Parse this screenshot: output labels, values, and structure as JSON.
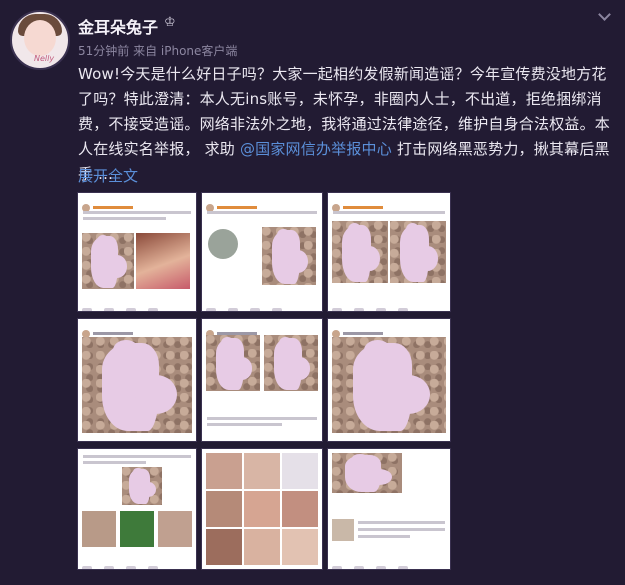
{
  "user": {
    "name": "金耳朵兔子",
    "avatar_caption": "Nelly",
    "meta": "51分钟前 来自 iPhone客户端"
  },
  "post": {
    "text_before_mention": "Wow!今天是什么好日子吗？大家一起相约发假新闻造谣？今年宣传费没地方花了吗？特此澄清：本人无ins账号，未怀孕，非圈内人士，不出道，拒绝捆绑消费，不接受造谣。网络非法外之地，我将通过法律途径，维护自身合法权益。本人在线实名举报， 求助 ",
    "mention": "@国家网信办举报中心",
    "text_after_mention": " 打击网络黑恶势力，揪其幕后黑手 ...",
    "expand_label": "展开全文"
  },
  "icons": {
    "vip": "crown-icon",
    "menu": "chevron-down-icon"
  },
  "colors": {
    "background": "#221b33",
    "link": "#5b8fd9",
    "meta": "#8c86a0"
  },
  "images": {
    "count": 9
  }
}
